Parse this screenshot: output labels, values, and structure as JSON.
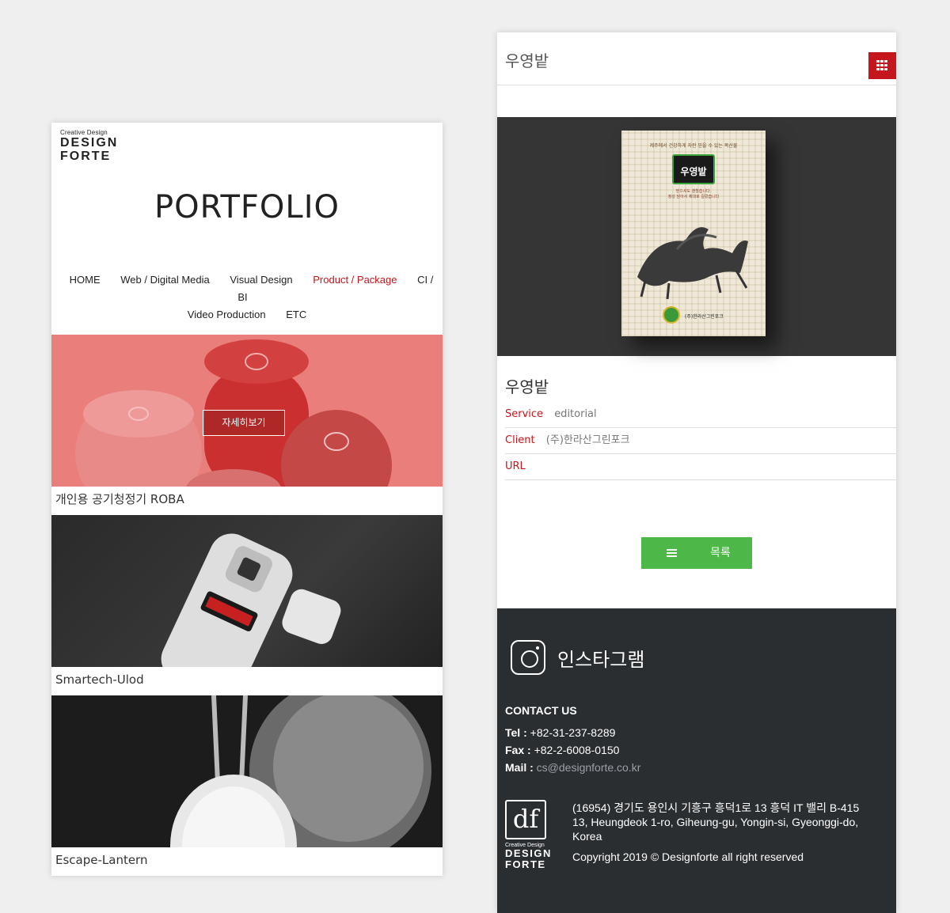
{
  "left": {
    "logo": {
      "tagline": "Creative Design",
      "line1": "DESIGN",
      "line2": "FORTE"
    },
    "title": "PORTFOLIO",
    "nav": [
      {
        "label": "HOME",
        "active": false
      },
      {
        "label": "Web / Digital Media",
        "active": false
      },
      {
        "label": "Visual Design",
        "active": false
      },
      {
        "label": "Product / Package",
        "active": true
      },
      {
        "label": "CI / BI",
        "active": false
      },
      {
        "label": "Video Production",
        "active": false
      },
      {
        "label": "ETC",
        "active": false
      }
    ],
    "cards": [
      {
        "caption": "개인용 공기청정기 ROBA",
        "overlay_label": "자세히보기"
      },
      {
        "caption": "Smartech-Ulod"
      },
      {
        "caption": "Escape-Lantern"
      }
    ]
  },
  "right": {
    "header_title": "우영밭",
    "book": {
      "top_text": "제주에서 건강하게 자란 믿을 수 있는 목산물",
      "badge": "우영밭",
      "sub_line1": "믿으셔도 괜찮습니다.",
      "sub_line2": "정성 담아서 제대로 길렀습니다",
      "publisher": "(주)한라산그린포크"
    },
    "project_title": "우영밭",
    "info": [
      {
        "key": "Service",
        "value": "editorial"
      },
      {
        "key": "Client",
        "value": "(주)한라산그린포크"
      },
      {
        "key": "URL",
        "value": ""
      }
    ],
    "list_button": "목록",
    "footer": {
      "instagram_label": "인스타그램",
      "contact_heading": "CONTACT US",
      "tel_label": "Tel :",
      "tel": "+82-31-237-8289",
      "fax_label": "Fax :",
      "fax": "+82-2-6008-0150",
      "mail_label": "Mail :",
      "mail": "cs@designforte.co.kr",
      "logo_mark": "df",
      "logo_tagline": "Creative Design",
      "logo_line1": "DESIGN",
      "logo_line2": "FORTE",
      "address_kr": "(16954) 경기도 용인시 기흥구 흥덕1로 13 흥덕 IT 밸리 B-415",
      "address_en": "13, Heungdeok 1-ro, Giheung-gu, Yongin-si, Gyeonggi-do, Korea",
      "copyright": "Copyright 2019 © Designforte all right reserved"
    }
  },
  "colors": {
    "accent": "#c4161c",
    "button_green": "#4db848",
    "footer_bg": "#2b2e31",
    "hero_bg": "#353535"
  },
  "icons": [
    "grid-menu-icon",
    "list-icon",
    "instagram-icon"
  ]
}
